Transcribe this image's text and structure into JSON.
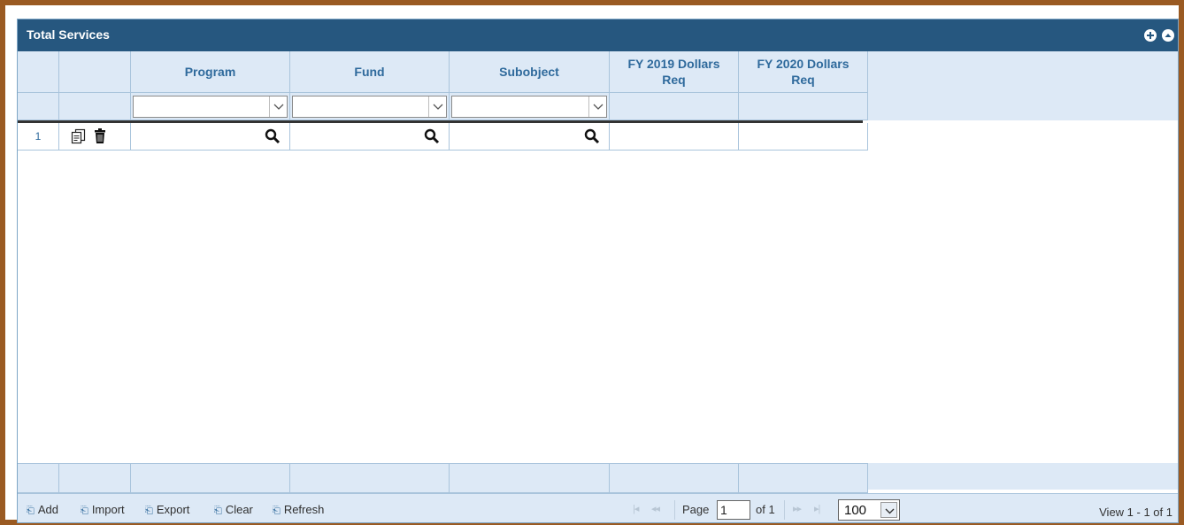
{
  "panel": {
    "title": "Total Services"
  },
  "columns": [
    {
      "key": "program",
      "label": "Program"
    },
    {
      "key": "fund",
      "label": "Fund"
    },
    {
      "key": "subobject",
      "label": "Subobject"
    },
    {
      "key": "fy2019",
      "label": "FY 2019 Dollars Req"
    },
    {
      "key": "fy2020",
      "label": "FY 2020 Dollars Req"
    }
  ],
  "rows": [
    {
      "num": "1",
      "program": "",
      "fund": "",
      "subobject": "",
      "fy2019": "",
      "fy2020": ""
    }
  ],
  "toolbar": {
    "add": "Add",
    "import": "Import",
    "export": "Export",
    "clear": "Clear",
    "refresh": "Refresh"
  },
  "pager": {
    "page_label": "Page",
    "page_value": "1",
    "of_label": "of 1",
    "rows_per_page": "100",
    "view_info": "View 1 - 1 of 1"
  },
  "colors": {
    "titlebar": "#26577f",
    "header_bg": "#dde9f6",
    "header_text": "#2f6a9c",
    "frame": "#9a5a22"
  },
  "icons": [
    "plus-circle-icon",
    "collapse-circle-icon",
    "copy-icon",
    "trash-icon",
    "search-icon",
    "chevron-down-icon",
    "external-link-icon"
  ]
}
